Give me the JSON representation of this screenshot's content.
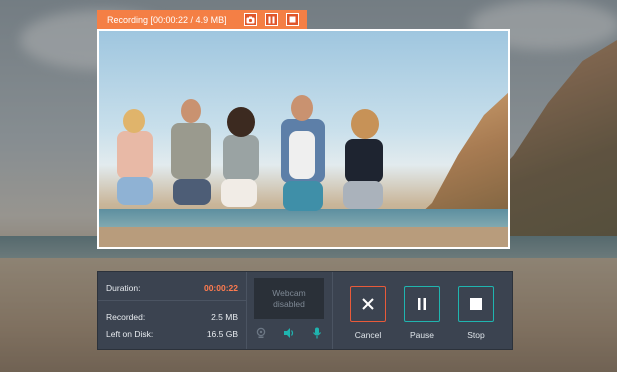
{
  "recording_bar": {
    "status": "Recording [00:00:22 / 4.9 MB]",
    "screenshot_icon": "camera-icon",
    "pause_icon": "pause-icon",
    "stop_icon": "stop-icon",
    "accent_color": "#f47f45"
  },
  "info": {
    "duration_label": "Duration:",
    "duration_value": "00:00:22",
    "recorded_label": "Recorded:",
    "recorded_value": "2.5 MB",
    "disk_label": "Left on Disk:",
    "disk_value": "16.5 GB"
  },
  "webcam": {
    "status_line1": "Webcam",
    "status_line2": "disabled",
    "icons": [
      "webcam-icon",
      "speaker-icon",
      "microphone-icon"
    ]
  },
  "controls": {
    "cancel_label": "Cancel",
    "pause_label": "Pause",
    "stop_label": "Stop",
    "cancel_color": "#e85a3a",
    "pause_color": "#1fb5b0",
    "stop_color": "#1fb5b0"
  }
}
